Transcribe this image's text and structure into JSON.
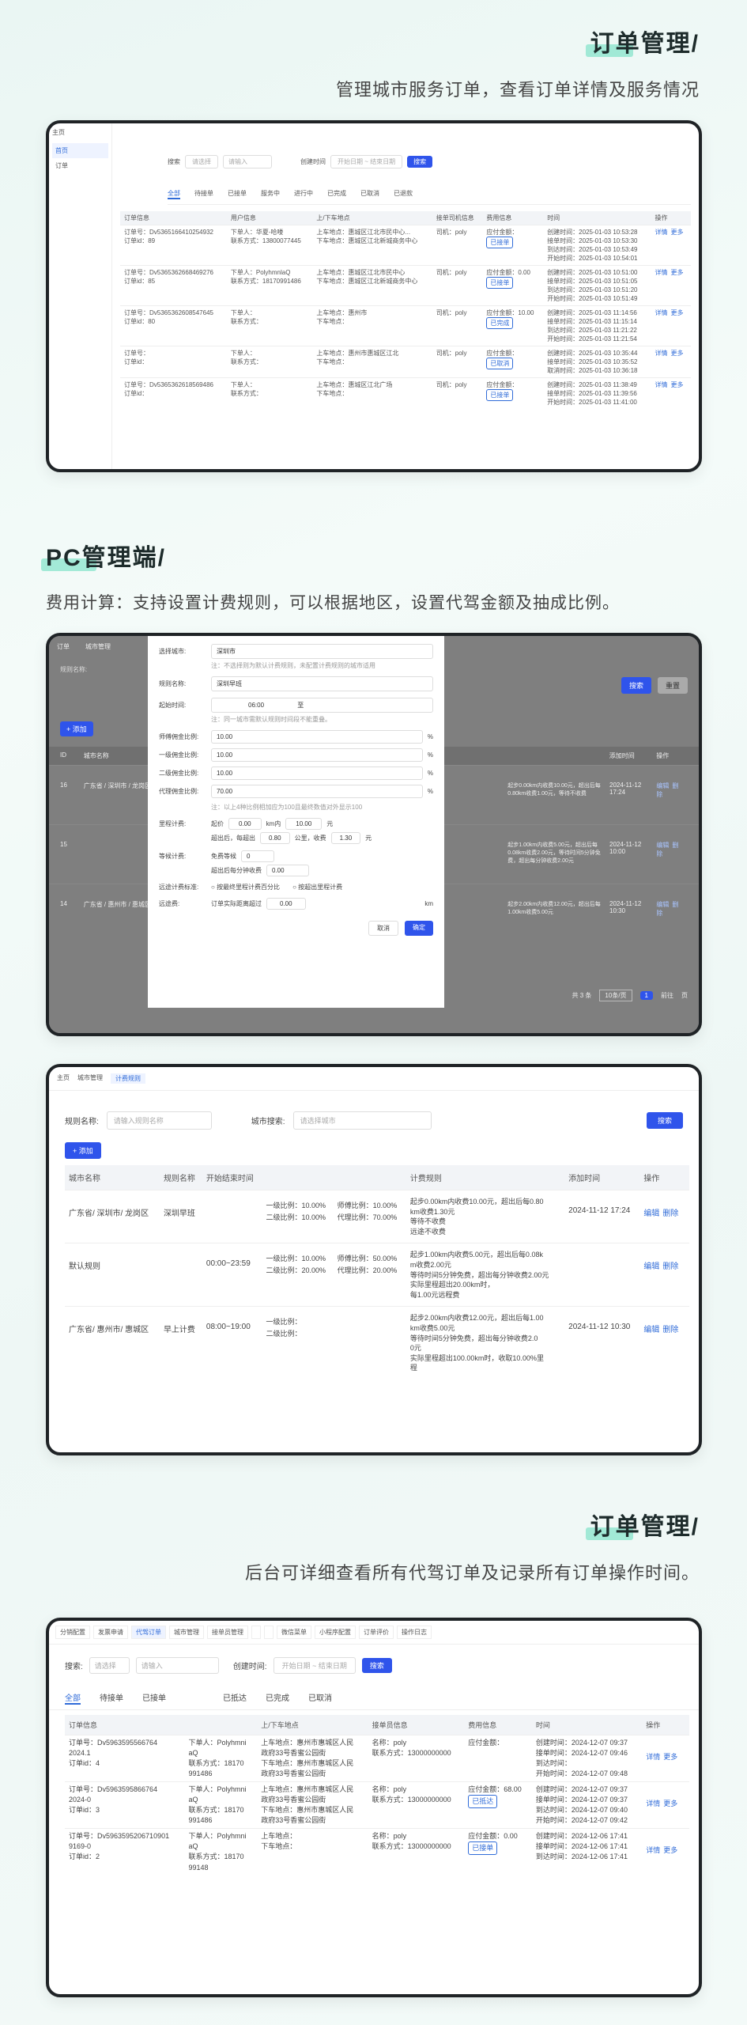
{
  "s1": {
    "title": "订单管理/",
    "subtitle": "管理城市服务订单，查看订单详情及服务情况",
    "sidebar": {
      "top": "主页",
      "items": [
        "首页",
        "订单"
      ]
    },
    "search": {
      "label": "搜索",
      "select": "请选择",
      "placeholder": "请输入",
      "date_label": "创建时间",
      "date_start": "开始日期",
      "date_sep": "~",
      "date_end": "结束日期",
      "btn": "搜索"
    },
    "tabs": [
      "全部",
      "待接单",
      "已接单",
      "服务中",
      "进行中",
      "已完成",
      "已取消",
      "已退款"
    ],
    "headers": [
      "订单信息",
      "用户信息",
      "上/下车地点",
      "接单司机信息",
      "费用信息",
      "时间",
      "操作"
    ],
    "rows": [
      {
        "order": "订单号：Dv5365166410254932",
        "order2": "订单id：89",
        "user": "下单人：华夏-哈喽",
        "phone": "联系方式：13800077445",
        "addr1": "上车地点：惠城区江北市民中心...",
        "addr2": "下车地点：惠城区江北新城商务中心",
        "driver": "司机：poly",
        "fee": "应付金额：",
        "tag": "已接单",
        "times": [
          "创建时间：2025-01-03 10:53:28",
          "接单时间：2025-01-03 10:53:30",
          "到达时间：2025-01-03 10:53:49",
          "开始时间：2025-01-03 10:54:01"
        ]
      },
      {
        "order": "订单号：Dv5365362668469276",
        "order2": "订单id：85",
        "user": "下单人：PolyhmnlaQ",
        "phone": "联系方式：18170991486",
        "addr1": "上车地点：惠城区江北市民中心",
        "addr2": "下车地点：惠城区江北新城商务中心",
        "driver": "司机：poly",
        "fee": "应付金额：0.00",
        "tag": "已接单",
        "times": [
          "创建时间：2025-01-03 10:51:00",
          "接单时间：2025-01-03 10:51:05",
          "到达时间：2025-01-03 10:51:20",
          "开始时间：2025-01-03 10:51:49"
        ]
      },
      {
        "order": "订单号：Dv5365362608547645",
        "order2": "订单id：80",
        "user": "下单人：",
        "phone": "联系方式：",
        "addr1": "上车地点：惠州市",
        "addr2": "下车地点：",
        "driver": "司机：poly",
        "fee": "应付金额：10.00",
        "tag": "已完成",
        "times": [
          "创建时间：2025-01-03 11:14:56",
          "接单时间：2025-01-03 11:15:14",
          "到达时间：2025-01-03 11:21:22",
          "开始时间：2025-01-03 11:21:54"
        ]
      },
      {
        "order": "订单号：",
        "order2": "订单id：",
        "user": "下单人：",
        "phone": "联系方式：",
        "addr1": "上车地点：惠州市惠城区江北",
        "addr2": "下车地点：",
        "driver": "司机：poly",
        "fee": "应付金额：",
        "tag": "已取消",
        "times": [
          "创建时间：2025-01-03 10:35:44",
          "接单时间：2025-01-03 10:35:52",
          "取消时间：2025-01-03 10:36:18"
        ]
      },
      {
        "order": "订单号：Dv5365362618569486",
        "order2": "订单id：",
        "user": "下单人：",
        "phone": "联系方式：",
        "addr1": "上车地点：惠城区江北广场",
        "addr2": "下车地点：",
        "driver": "司机：poly",
        "fee": "应付金额：",
        "tag": "已接单",
        "times": [
          "创建时间：2025-01-03 11:38:49",
          "接单时间：2025-01-03 11:39:56",
          "开始时间：2025-01-03 11:41:00"
        ]
      }
    ],
    "actions": [
      "详情",
      "更多"
    ]
  },
  "s2": {
    "title": "PC管理端/",
    "subtitle": "费用计算：支持设置计费规则，可以根据地区，设置代驾金额及抽成比例。",
    "tabs": [
      "订单",
      "城市管理"
    ],
    "search_label": "规则名称:",
    "search_placeholder": "请输入规则名称",
    "search_btn": "搜索",
    "reset_btn": "重置",
    "add_btn": "+ 添加",
    "headers": [
      "ID",
      "城市名称",
      "",
      "添加时间",
      "操作"
    ],
    "rows": [
      {
        "id": "16",
        "city": "广东省 / 深圳市 / 龙岗区",
        "rule": "起步0.00km内收费10.00元，超出后每0.80km收费1.00元，等待不收费",
        "time": "2024-11-12 17:24",
        "ops": [
          "编辑",
          "删除"
        ]
      },
      {
        "id": "15",
        "city": "",
        "rule": "起步1.00km内收费5.00元，超出后每0.08km收费2.00元，等待时间5分钟免费，超出每分钟收费2.00元",
        "time": "2024-11-12 10:00",
        "ops": [
          "编辑",
          "删除"
        ]
      },
      {
        "id": "14",
        "city": "广东省 / 惠州市 / 惠城区",
        "rule": "起步2.00km内收费12.00元，超出后每1.00km收费5.00元",
        "time": "2024-11-12 10:30",
        "ops": [
          "编辑",
          "删除"
        ]
      }
    ],
    "pager": {
      "total": "共 3 条",
      "size": "10条/页",
      "page": "1",
      "goto": "前往",
      "page_unit": "页"
    },
    "modal": {
      "city_label": "选择城市:",
      "city_value": "深圳市",
      "city_note": "注：不选择则为默认计费规则，未配置计费规则的城市适用",
      "name_label": "规则名称:",
      "name_value": "深圳早班",
      "time_label": "起始时间:",
      "time_start": "06:00",
      "time_to": "至",
      "time_note": "注：同一城市需默认规则时间段不能重叠。",
      "r1_label": "师傅佣金比例:",
      "r1_value": "10.00",
      "r2_label": "一级佣金比例:",
      "r2_value": "10.00",
      "r3_label": "二级佣金比例:",
      "r3_value": "10.00",
      "r4_label": "代理佣金比例:",
      "r4_value": "70.00",
      "pct": "%",
      "ratio_note": "注：以上4种比例相加应为100且最终数值对外显示100",
      "start_label": "里程计费:",
      "start_a": "起价",
      "start_a_val": "0.00",
      "start_b": "km内",
      "start_b_val": "10.00",
      "start_c": "元",
      "over_a": "超出后，每超出",
      "over_a_val": "0.80",
      "over_b": "公里，收费",
      "over_b_val": "1.30",
      "over_c": "元",
      "wait_label": "等候计费:",
      "wait_a": "免费等候",
      "wait_a_val": "0",
      "wait_b": "超出后每分钟收费",
      "wait_b_val": "0.00",
      "remote_label": "远途计费标准:",
      "remote_a": "按最终里程计费百分比",
      "remote_b": "按超出里程计费",
      "far_label": "远途费:",
      "far_a": "订单实际距离超过",
      "far_a_val": "0.00",
      "far_unit": "km",
      "cancel": "取消",
      "ok": "确定"
    }
  },
  "s3": {
    "breadcrumb": [
      "主页",
      "城市管理",
      "计费规则"
    ],
    "search_label": "规则名称:",
    "search_placeholder": "请输入规则名称",
    "city_label": "城市搜索:",
    "city_placeholder": "请选择城市",
    "search_btn": "搜索",
    "add_btn": "+ 添加",
    "headers": [
      "城市名称",
      "规则名称",
      "开始结束时间",
      "",
      "计费规则",
      "添加时间",
      "操作"
    ],
    "rows": [
      {
        "city": "广东省/ 深圳市/ 龙岗区",
        "name": "深圳早班",
        "time": "",
        "r1": "一级比例：10.00%",
        "r2": "二级比例：10.00%",
        "r3": "师傅比例：10.00%",
        "r4": "代理比例：70.00%",
        "rule": [
          "起步0.00km内收费10.00元，超出后每0.80",
          "km收费1.30元",
          "等待不收费",
          "远途不收费"
        ],
        "added": "2024-11-12 17:24",
        "ops": [
          "编辑",
          "删除"
        ]
      },
      {
        "city": "默认规则",
        "name": "",
        "time": "00:00~23:59",
        "r1": "一级比例：10.00%",
        "r2": "二级比例：20.00%",
        "r3": "师傅比例：50.00%",
        "r4": "代理比例：20.00%",
        "rule": [
          "起步1.00km内收费5.00元，超出后每0.08k",
          "m收费2.00元",
          "等待时间5分钟免费，超出每分钟收费2.00元",
          "实际里程超出20.00km时，",
          "每1.00元远程费"
        ],
        "added": "",
        "ops": [
          "编辑",
          "删除"
        ]
      },
      {
        "city": "广东省/ 惠州市/ 惠城区",
        "name": "早上计费",
        "time": "08:00~19:00",
        "r1": "一级比例：",
        "r2": "二级比例：",
        "r3": "",
        "r4": "",
        "rule": [
          "起步2.00km内收费12.00元，超出后每1.00",
          "km收费5.00元",
          "等待时间5分钟免费，超出每分钟收费2.0",
          "0元",
          "实际里程超出100.00km时，收取10.00%里",
          "程"
        ],
        "added": "2024-11-12 10:30",
        "ops": [
          "编辑",
          "删除"
        ]
      }
    ]
  },
  "s4": {
    "title": "订单管理/",
    "subtitle": "后台可详细查看所有代驾订单及记录所有订单操作时间。",
    "toptabs": [
      "分销配置",
      "发票申请",
      "代驾订单",
      "城市管理",
      "接单员管理",
      "",
      "",
      "微信菜单",
      "小程序配置",
      "订单评价",
      "操作日志"
    ],
    "search": {
      "label": "搜索:",
      "select": "请选择",
      "placeholder": "请输入",
      "date_label": "创建时间:",
      "date_start": "开始日期",
      "date_sep": "~",
      "date_end": "结束日期",
      "btn": "搜索"
    },
    "tabs": [
      "全部",
      "待接单",
      "已接单",
      "",
      "",
      "已抵达",
      "已完成",
      "已取消"
    ],
    "headers": [
      "订单信息",
      "",
      "上/下车地点",
      "接单员信息",
      "费用信息",
      "时间",
      "操作"
    ],
    "rows": [
      {
        "o1": "订单号：Dv5963595566764",
        "o2": "2024.1",
        "o3": "订单id：4",
        "u1": "下单人：Polyhmni",
        "u2": "aQ",
        "u3": "联系方式：18170",
        "u4": "991486",
        "a1": "上车地点：惠州市惠城区人民",
        "a2": "政府33号香蜜公园街",
        "a3": "下车地点：惠州市惠城区人民",
        "a4": "政府33号香蜜公园街",
        "d1": "名称：poly",
        "d2": "联系方式：13000000000",
        "f1": "应付金额：",
        "tag": "",
        "t": [
          "创建时间：2024-12-07 09:37",
          "接单时间：2024-12-07 09:46",
          "到达时间：",
          "开始时间：2024-12-07 09:48"
        ]
      },
      {
        "o1": "订单号：Dv5963595866764",
        "o2": "2024-0",
        "o3": "订单id：3",
        "u1": "下单人：Polyhmni",
        "u2": "aQ",
        "u3": "联系方式：18170",
        "u4": "991486",
        "a1": "上车地点：惠州市惠城区人民",
        "a2": "政府33号香蜜公园街",
        "a3": "下车地点：惠州市惠城区人民",
        "a4": "政府33号香蜜公园街",
        "d1": "名称：poly",
        "d2": "联系方式：13000000000",
        "f1": "应付金额：68.00",
        "tag": "已抵达",
        "t": [
          "创建时间：2024-12-07 09:37",
          "接单时间：2024-12-07 09:37",
          "到达时间：2024-12-07 09:40",
          "开始时间：2024-12-07 09:42"
        ]
      },
      {
        "o1": "订单号：Dv5963595206710901",
        "o2": "9169-0",
        "o3": "订单id：2",
        "u1": "下单人：Polyhmni",
        "u2": "aQ",
        "u3": "联系方式：18170",
        "u4": "99148",
        "a1": "上车地点：",
        "a2": "",
        "a3": "下车地点：",
        "a4": "",
        "d1": "名称：poly",
        "d2": "联系方式：13000000000",
        "f1": "应付金额：0.00",
        "tag": "已接单",
        "t": [
          "创建时间：2024-12-06 17:41",
          "接单时间：2024-12-06 17:41",
          "到达时间：2024-12-06 17:41",
          ""
        ]
      }
    ],
    "ops": [
      "详情",
      "更多"
    ]
  }
}
